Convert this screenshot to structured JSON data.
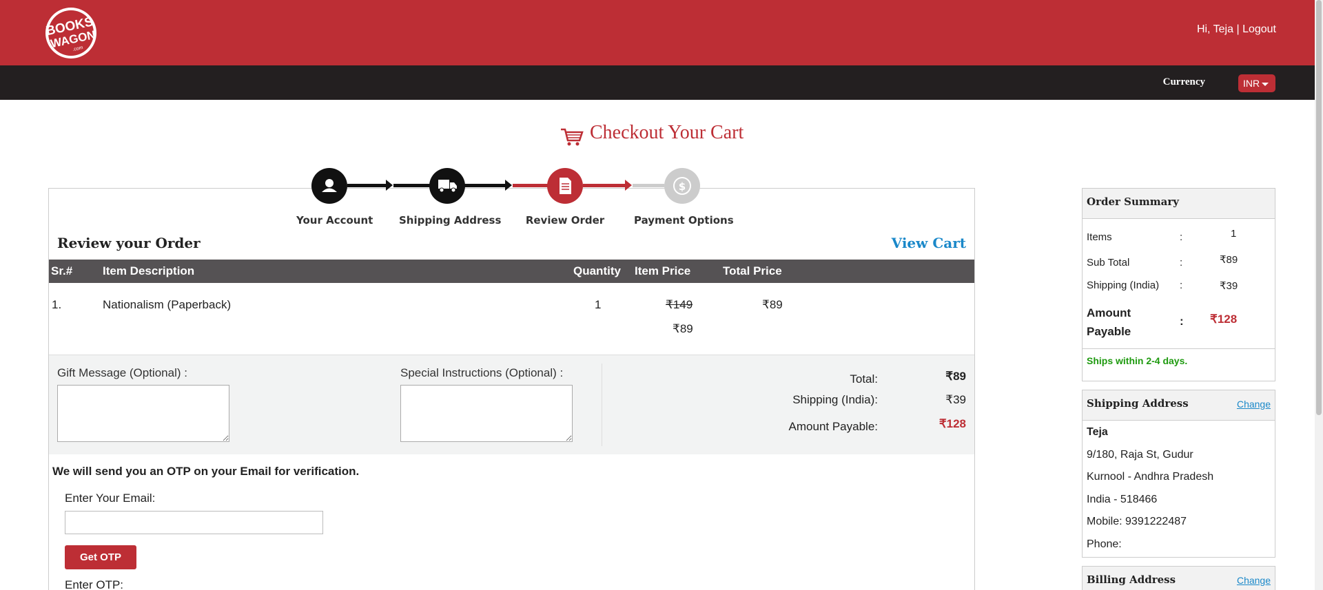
{
  "header": {
    "brand": "BOOKS WAGON .com",
    "greeting": "Hi, Teja",
    "separator": "|",
    "logout": "Logout",
    "currency_label": "Currency",
    "currency_value": "INR",
    "brand_color": "#bd2e35"
  },
  "page": {
    "title": "Checkout Your Cart"
  },
  "steps": [
    {
      "label": "Your Account",
      "icon": "user-icon",
      "state": "done"
    },
    {
      "label": "Shipping Address",
      "icon": "truck-icon",
      "state": "done"
    },
    {
      "label": "Review Order",
      "icon": "document-icon",
      "state": "active"
    },
    {
      "label": "Payment Options",
      "icon": "dollar-icon",
      "state": "pending"
    }
  ],
  "review": {
    "title": "Review your Order",
    "view_cart": "View Cart",
    "columns": [
      "Sr.#",
      "Item Description",
      "Quantity",
      "Item Price",
      "Total Price"
    ],
    "items": [
      {
        "sr": "1.",
        "description": "Nationalism (Paperback)",
        "quantity": "1",
        "list_price": "₹149",
        "price": "₹89",
        "total": "₹89"
      }
    ]
  },
  "extras": {
    "gift_label": "Gift Message (Optional) :",
    "instructions_label": "Special Instructions (Optional) :",
    "total_label": "Total:",
    "total_value": "₹89",
    "shipping_label": "Shipping (India):",
    "shipping_value": "₹39",
    "payable_label": "Amount Payable:",
    "payable_value": "₹128"
  },
  "otp": {
    "note": "We will send you an OTP on your Email for verification.",
    "email_label": "Enter Your Email:",
    "email_value": "",
    "button": "Get OTP",
    "otp_label": "Enter OTP:"
  },
  "summary": {
    "title": "Order Summary",
    "items_label": "Items",
    "items_value": "1",
    "subtotal_label": "Sub Total",
    "subtotal_value": "₹89",
    "shipping_label": "Shipping (India)",
    "shipping_value": "₹39",
    "payable_label_1": "Amount",
    "payable_label_2": "Payable",
    "payable_value": "₹128",
    "colon": ":",
    "ships_note": "Ships within 2-4 days."
  },
  "shipping_address": {
    "title": "Shipping Address",
    "change": "Change",
    "name": "Teja",
    "line1": "9/180, Raja St, Gudur",
    "line2": "Kurnool - Andhra Pradesh",
    "line3": "India - 518466",
    "mobile": "Mobile: 9391222487",
    "phone": "Phone:"
  },
  "billing_address": {
    "title": "Billing Address",
    "change": "Change"
  }
}
